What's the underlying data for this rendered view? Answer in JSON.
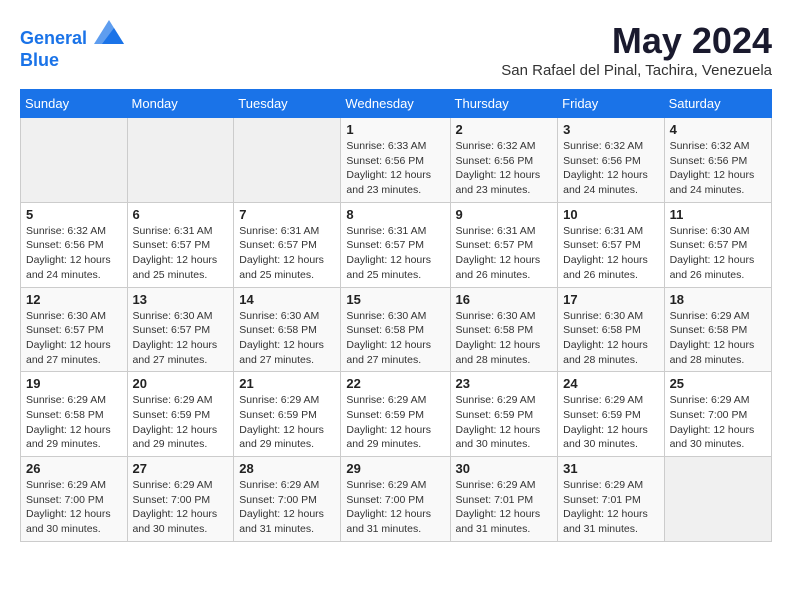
{
  "header": {
    "logo_line1": "General",
    "logo_line2": "Blue",
    "month": "May 2024",
    "location": "San Rafael del Pinal, Tachira, Venezuela"
  },
  "days_of_week": [
    "Sunday",
    "Monday",
    "Tuesday",
    "Wednesday",
    "Thursday",
    "Friday",
    "Saturday"
  ],
  "weeks": [
    [
      {
        "day": "",
        "info": ""
      },
      {
        "day": "",
        "info": ""
      },
      {
        "day": "",
        "info": ""
      },
      {
        "day": "1",
        "info": "Sunrise: 6:33 AM\nSunset: 6:56 PM\nDaylight: 12 hours\nand 23 minutes."
      },
      {
        "day": "2",
        "info": "Sunrise: 6:32 AM\nSunset: 6:56 PM\nDaylight: 12 hours\nand 23 minutes."
      },
      {
        "day": "3",
        "info": "Sunrise: 6:32 AM\nSunset: 6:56 PM\nDaylight: 12 hours\nand 24 minutes."
      },
      {
        "day": "4",
        "info": "Sunrise: 6:32 AM\nSunset: 6:56 PM\nDaylight: 12 hours\nand 24 minutes."
      }
    ],
    [
      {
        "day": "5",
        "info": "Sunrise: 6:32 AM\nSunset: 6:56 PM\nDaylight: 12 hours\nand 24 minutes."
      },
      {
        "day": "6",
        "info": "Sunrise: 6:31 AM\nSunset: 6:57 PM\nDaylight: 12 hours\nand 25 minutes."
      },
      {
        "day": "7",
        "info": "Sunrise: 6:31 AM\nSunset: 6:57 PM\nDaylight: 12 hours\nand 25 minutes."
      },
      {
        "day": "8",
        "info": "Sunrise: 6:31 AM\nSunset: 6:57 PM\nDaylight: 12 hours\nand 25 minutes."
      },
      {
        "day": "9",
        "info": "Sunrise: 6:31 AM\nSunset: 6:57 PM\nDaylight: 12 hours\nand 26 minutes."
      },
      {
        "day": "10",
        "info": "Sunrise: 6:31 AM\nSunset: 6:57 PM\nDaylight: 12 hours\nand 26 minutes."
      },
      {
        "day": "11",
        "info": "Sunrise: 6:30 AM\nSunset: 6:57 PM\nDaylight: 12 hours\nand 26 minutes."
      }
    ],
    [
      {
        "day": "12",
        "info": "Sunrise: 6:30 AM\nSunset: 6:57 PM\nDaylight: 12 hours\nand 27 minutes."
      },
      {
        "day": "13",
        "info": "Sunrise: 6:30 AM\nSunset: 6:57 PM\nDaylight: 12 hours\nand 27 minutes."
      },
      {
        "day": "14",
        "info": "Sunrise: 6:30 AM\nSunset: 6:58 PM\nDaylight: 12 hours\nand 27 minutes."
      },
      {
        "day": "15",
        "info": "Sunrise: 6:30 AM\nSunset: 6:58 PM\nDaylight: 12 hours\nand 27 minutes."
      },
      {
        "day": "16",
        "info": "Sunrise: 6:30 AM\nSunset: 6:58 PM\nDaylight: 12 hours\nand 28 minutes."
      },
      {
        "day": "17",
        "info": "Sunrise: 6:30 AM\nSunset: 6:58 PM\nDaylight: 12 hours\nand 28 minutes."
      },
      {
        "day": "18",
        "info": "Sunrise: 6:29 AM\nSunset: 6:58 PM\nDaylight: 12 hours\nand 28 minutes."
      }
    ],
    [
      {
        "day": "19",
        "info": "Sunrise: 6:29 AM\nSunset: 6:58 PM\nDaylight: 12 hours\nand 29 minutes."
      },
      {
        "day": "20",
        "info": "Sunrise: 6:29 AM\nSunset: 6:59 PM\nDaylight: 12 hours\nand 29 minutes."
      },
      {
        "day": "21",
        "info": "Sunrise: 6:29 AM\nSunset: 6:59 PM\nDaylight: 12 hours\nand 29 minutes."
      },
      {
        "day": "22",
        "info": "Sunrise: 6:29 AM\nSunset: 6:59 PM\nDaylight: 12 hours\nand 29 minutes."
      },
      {
        "day": "23",
        "info": "Sunrise: 6:29 AM\nSunset: 6:59 PM\nDaylight: 12 hours\nand 30 minutes."
      },
      {
        "day": "24",
        "info": "Sunrise: 6:29 AM\nSunset: 6:59 PM\nDaylight: 12 hours\nand 30 minutes."
      },
      {
        "day": "25",
        "info": "Sunrise: 6:29 AM\nSunset: 7:00 PM\nDaylight: 12 hours\nand 30 minutes."
      }
    ],
    [
      {
        "day": "26",
        "info": "Sunrise: 6:29 AM\nSunset: 7:00 PM\nDaylight: 12 hours\nand 30 minutes."
      },
      {
        "day": "27",
        "info": "Sunrise: 6:29 AM\nSunset: 7:00 PM\nDaylight: 12 hours\nand 30 minutes."
      },
      {
        "day": "28",
        "info": "Sunrise: 6:29 AM\nSunset: 7:00 PM\nDaylight: 12 hours\nand 31 minutes."
      },
      {
        "day": "29",
        "info": "Sunrise: 6:29 AM\nSunset: 7:00 PM\nDaylight: 12 hours\nand 31 minutes."
      },
      {
        "day": "30",
        "info": "Sunrise: 6:29 AM\nSunset: 7:01 PM\nDaylight: 12 hours\nand 31 minutes."
      },
      {
        "day": "31",
        "info": "Sunrise: 6:29 AM\nSunset: 7:01 PM\nDaylight: 12 hours\nand 31 minutes."
      },
      {
        "day": "",
        "info": ""
      }
    ]
  ]
}
